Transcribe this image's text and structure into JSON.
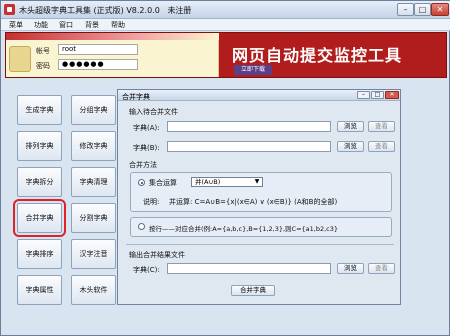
{
  "window": {
    "title": "木头超级字典工具集 (正式版) V8.2.0.0",
    "registration": "未注册",
    "min": "–",
    "max": "□",
    "close": "✕"
  },
  "menu": [
    "菜单",
    "功能",
    "窗口",
    "背景",
    "帮助"
  ],
  "login": {
    "account_label": "帐号",
    "account_value": "root",
    "password_label": "密码",
    "password_value": "●●●●●●"
  },
  "promo": {
    "title": "网页自动提交监控工具",
    "button": "立即下载"
  },
  "left_buttons": [
    [
      "生成字典",
      "分组字典"
    ],
    [
      "排列字典",
      "修改字典"
    ],
    [
      "字典拆分",
      "字典清理"
    ],
    [
      "合并字典",
      "分割字典"
    ],
    [
      "字典排序",
      "汉字注音"
    ],
    [
      "字典属性",
      "木头软件"
    ]
  ],
  "dialog": {
    "title": "合并字典",
    "input_section": "输入待合并文件",
    "dict_a_label": "字典(A):",
    "dict_b_label": "字典(B):",
    "browse": "浏览",
    "view": "查看",
    "method_section": "合并方法",
    "set_op_label": "集合运算",
    "set_op_value": "并(A∪B)",
    "desc_label": "说明:",
    "desc_text": "并运算: C=A∪B={x|(x∈A) ∨ (x∈B)} (A和B的全部)",
    "pairwise_label": "按行——对应合并(例:A={a,b,c},B={1,2,3},则C={a1,b2,c3}",
    "output_section": "输出合并结果文件",
    "dict_c_label": "字典(C):",
    "merge_button": "合并字典"
  }
}
